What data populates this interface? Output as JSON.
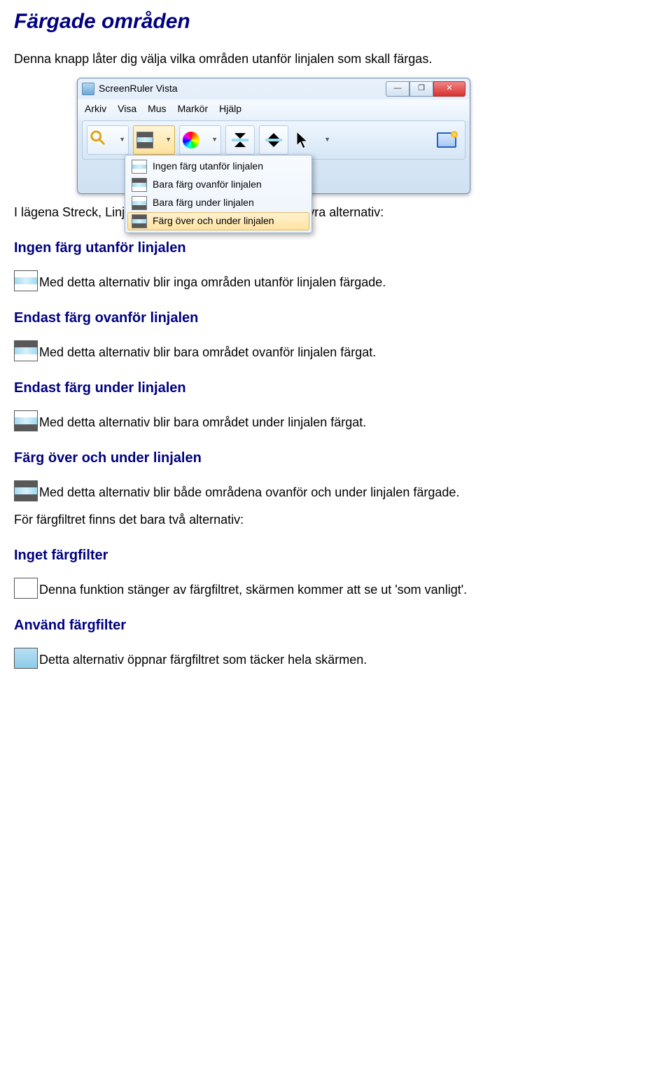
{
  "page": {
    "title": "Färgade områden",
    "intro": "Denna knapp låter dig välja vilka områden utanför linjalen som skall färgas.",
    "after_screenshot": "I lägena Streck, Linjal och Förstoringslinjal finns det fyra alternativ:"
  },
  "screenshot": {
    "title": "ScreenRuler Vista",
    "menu": [
      "Arkiv",
      "Visa",
      "Mus",
      "Markör",
      "Hjälp"
    ],
    "dropdown_items": [
      "Ingen färg utanför linjalen",
      "Bara färg ovanför linjalen",
      "Bara färg under linjalen",
      "Färg över och under linjalen"
    ]
  },
  "sections": [
    {
      "heading": "Ingen färg utanför linjalen",
      "icon": [
        "white",
        "blue",
        "white"
      ],
      "text": "Med detta alternativ blir inga områden utanför linjalen färgade."
    },
    {
      "heading": "Endast färg ovanför linjalen",
      "icon": [
        "dark",
        "blue",
        "white"
      ],
      "text": "Med detta alternativ blir bara området ovanför linjalen färgat."
    },
    {
      "heading": "Endast färg under linjalen",
      "icon": [
        "white",
        "blue",
        "dark"
      ],
      "text": "Med detta alternativ blir bara området under linjalen färgat."
    },
    {
      "heading": "Färg över och under linjalen",
      "icon": [
        "dark",
        "blue",
        "dark"
      ],
      "text": "Med detta alternativ blir både områdena ovanför och under linjalen färgade."
    }
  ],
  "filter_intro": "För färgfiltret finns det bara två alternativ:",
  "filter_sections": [
    {
      "heading": "Inget färgfilter",
      "icon_type": "plain-white",
      "text": "Denna funktion stänger av färgfiltret, skärmen kommer att se ut 'som vanligt'."
    },
    {
      "heading": "Använd färgfilter",
      "icon_type": "plain-blue",
      "text": "Detta alternativ öppnar färgfiltret som täcker hela skärmen."
    }
  ]
}
